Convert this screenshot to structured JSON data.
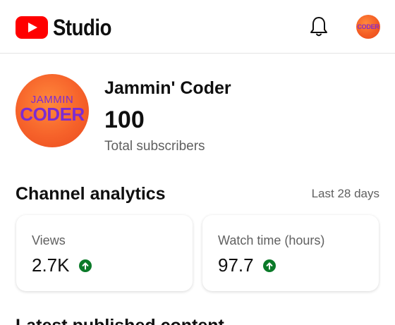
{
  "header": {
    "app_name": "Studio",
    "logo_icon": "youtube-play-icon",
    "notifications_icon": "bell-icon",
    "avatar_text": "CODER"
  },
  "channel": {
    "avatar_line1": "JAMMIN",
    "avatar_line2": "CODER",
    "name": "Jammin' Coder",
    "subscribers": "100",
    "subscribers_label": "Total subscribers"
  },
  "analytics": {
    "title": "Channel analytics",
    "range": "Last 28 days",
    "cards": [
      {
        "label": "Views",
        "value": "2.7K",
        "trend_icon": "arrow-up-icon"
      },
      {
        "label": "Watch time (hours)",
        "value": "97.7",
        "trend_icon": "arrow-up-icon"
      }
    ]
  },
  "next_section": {
    "title": "Latest published content"
  },
  "colors": {
    "brand_red": "#ff0000",
    "trend_green": "#0b7a29",
    "avatar_orange": "#f6622a",
    "avatar_text_purple": "#7d2bd1"
  }
}
